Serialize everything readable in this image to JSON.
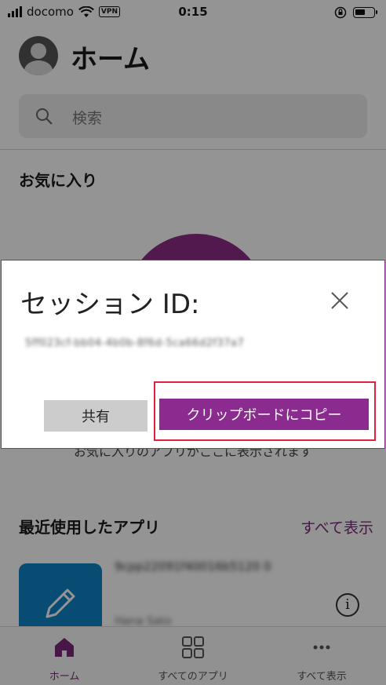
{
  "status_bar": {
    "carrier": "docomo",
    "vpn": "VPN",
    "time": "0:15"
  },
  "header": {
    "title": "ホーム"
  },
  "search": {
    "placeholder": "検索"
  },
  "favorites": {
    "title": "お気に入り",
    "empty_text": "お気に入りのアプリがここに表示されます"
  },
  "recent": {
    "title": "最近使用したアプリ",
    "see_all": "すべて表示",
    "items": [
      {
        "name": "9cpp22091f40016b5120 0",
        "owner": "Hana Sato"
      }
    ]
  },
  "bottom_nav": {
    "items": [
      {
        "label": "ホーム",
        "icon": "home-icon",
        "active": true
      },
      {
        "label": "すべてのアプリ",
        "icon": "grid-icon",
        "active": false
      },
      {
        "label": "すべて表示",
        "icon": "more-icon",
        "active": false
      }
    ]
  },
  "dialog": {
    "title": "セッション ID:",
    "session_id": "5ff023cf-bb04-4b0b-8f6d-5ca66d2f37a7",
    "share_label": "共有",
    "copy_label": "クリップボードにコピー"
  },
  "colors": {
    "accent": "#8b2a8f",
    "highlight_border": "#e02040",
    "app_tile": "#0f83c9"
  }
}
